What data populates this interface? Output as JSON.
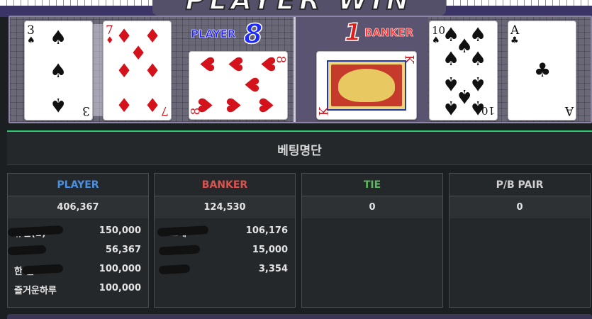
{
  "banner": {
    "text": "PLAYER WIN"
  },
  "table": {
    "player": {
      "label": "PLAYER",
      "score": "8"
    },
    "banker": {
      "label": "BANKER",
      "score": "1"
    }
  },
  "cards": {
    "player": [
      {
        "rank": "3",
        "suit": "♠",
        "color": "black"
      },
      {
        "rank": "7",
        "suit": "♦",
        "color": "red"
      },
      {
        "rank": "8",
        "suit": "♥",
        "color": "red"
      }
    ],
    "banker": [
      {
        "rank": "K",
        "suit": "♥",
        "color": "red"
      },
      {
        "rank": "10",
        "suit": "♠",
        "color": "black"
      },
      {
        "rank": "A",
        "suit": "♣",
        "color": "black"
      }
    ]
  },
  "betlist": {
    "title": "베팅명단",
    "columns": [
      {
        "label": "PLAYER",
        "color": "#4a90e2",
        "total": "406,367",
        "rows": [
          {
            "name": "유현(2)",
            "amount": "150,000"
          },
          {
            "name": "",
            "amount": "56,367"
          },
          {
            "name": "한 근",
            "amount": "100,000"
          },
          {
            "name": "즐거운하루",
            "amount": "100,000"
          }
        ]
      },
      {
        "label": "BANKER",
        "color": "#d9534f",
        "total": "124,530",
        "rows": [
          {
            "name": "ㅅ도깨",
            "amount": "106,176"
          },
          {
            "name": "",
            "amount": "15,000"
          },
          {
            "name": "",
            "amount": "3,354"
          }
        ]
      },
      {
        "label": "TIE",
        "color": "#5cb85c",
        "total": "0",
        "rows": []
      },
      {
        "label": "P/B PAIR",
        "color": "#cfcfcf",
        "total": "0",
        "rows": []
      }
    ]
  }
}
